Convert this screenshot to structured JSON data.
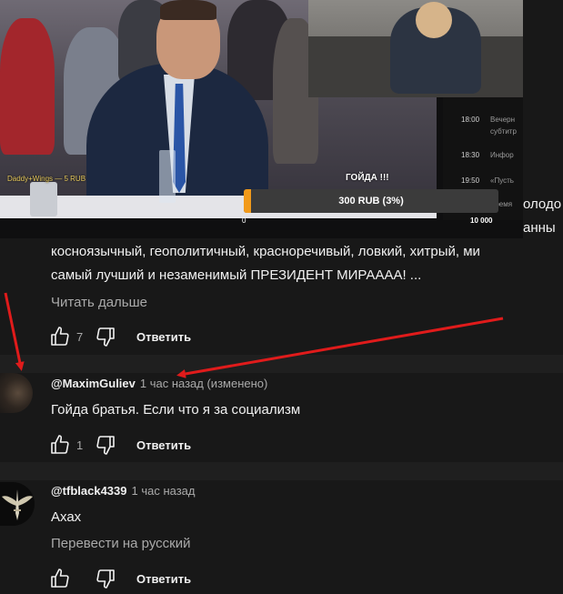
{
  "video": {
    "donor_label": "Daddy+Wings — 5 RUB",
    "goal_title": "ГОЙДА !!!",
    "goal_text": "300 RUB (3%)",
    "goal_progress_percent": 3,
    "goal_min": "0",
    "goal_max": "10 000",
    "schedule": [
      {
        "time": "18:00",
        "title": "Вечерн"
      },
      {
        "time": "",
        "title": "субтитр"
      },
      {
        "time": "18:30",
        "title": "Инфор"
      },
      {
        "time": "19:50",
        "title": "«Пусть"
      },
      {
        "time": "",
        "title": "Время"
      }
    ]
  },
  "comment1": {
    "partial_line_top": "олодо",
    "partial_line_right": "анны",
    "line1": "косноязычный, геополитичный, красноречивый, ловкий, хитрый, ми",
    "line2": "самый лучший и незаменимый ПРЕЗИДЕНТ МИРАААА! ...",
    "read_more": "Читать дальше",
    "likes": "7",
    "reply_label": "Ответить"
  },
  "comment2": {
    "handle": "@MaximGuliev",
    "meta": "1 час назад (изменено)",
    "text": "Гойда братья. Если что я за социализм",
    "likes": "1",
    "reply_label": "Ответить"
  },
  "comment3": {
    "handle": "@tfblack4339",
    "meta": "1 час назад",
    "text": "Ахах",
    "translate": "Перевести на русский",
    "likes": "",
    "reply_label": "Ответить"
  },
  "colors": {
    "background": "#181818",
    "separator": "#1f1f1f",
    "secondary_text": "#aaaaaa",
    "goal_fill": "#f29a1a",
    "annotation_arrow": "#e01b1b"
  }
}
